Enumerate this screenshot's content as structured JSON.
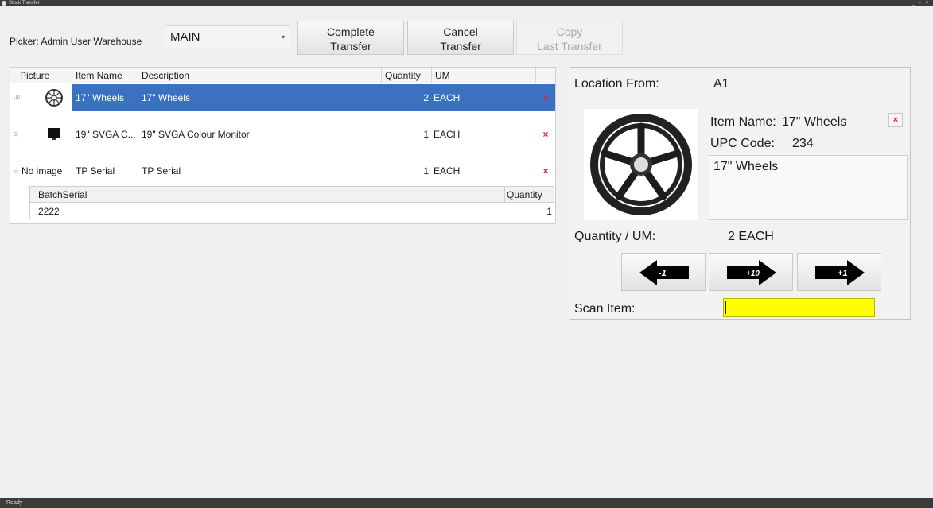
{
  "window": {
    "title": "Stock Transfer",
    "controls": "_ ▫ ×"
  },
  "toolbar": {
    "picker_label": "Picker: Admin User Warehouse",
    "warehouse_value": "MAIN",
    "complete_line1": "Complete",
    "complete_line2": "Transfer",
    "cancel_line1": "Cancel",
    "cancel_line2": "Transfer",
    "copy_line1": "Copy",
    "copy_line2": "Last Transfer"
  },
  "grid": {
    "headers": [
      "Picture",
      "Item Name",
      "Description",
      "Quantity",
      "UM"
    ],
    "rows": [
      {
        "picture": "wheel-icon",
        "item_name": "17\" Wheels",
        "description": "17\" Wheels",
        "quantity": "2",
        "um": "EACH",
        "selected": true
      },
      {
        "picture": "monitor-icon",
        "item_name": "19\" SVGA C...",
        "description": "19\" SVGA Colour Monitor",
        "quantity": "1",
        "um": "EACH",
        "selected": false
      },
      {
        "picture": "No image",
        "item_name": "TP Serial",
        "description": "TP Serial",
        "quantity": "1",
        "um": "EACH",
        "selected": false
      }
    ],
    "sub_headers": [
      "BatchSerial",
      "Quantity"
    ],
    "sub_rows": [
      {
        "batch_serial": "2222",
        "quantity": "1"
      }
    ]
  },
  "panel": {
    "location_label": "Location From:",
    "location_value": "A1",
    "item_name_label": "Item Name:",
    "item_name_value": "17\" Wheels",
    "upc_label": "UPC Code:",
    "upc_value": "234",
    "description": "17\" Wheels",
    "qty_label": "Quantity / UM:",
    "qty_value": "2 EACH",
    "minus_one": "-1",
    "plus_ten": "+10",
    "plus_one": "+1",
    "scan_label": "Scan Item:",
    "scan_value": ""
  },
  "status": {
    "text": "Ready"
  },
  "colors": {
    "selection": "#3a71c1",
    "scan_bg": "#ffff00",
    "delete": "#dd2222"
  }
}
